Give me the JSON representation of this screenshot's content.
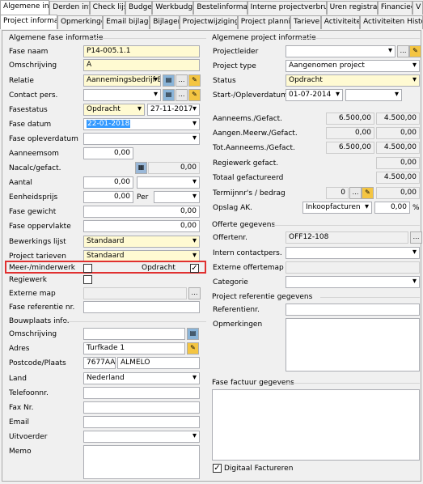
{
  "tabs_row1": [
    "Algemene info.",
    "Derden info",
    "Check lijst",
    "Budget",
    "Werkbudget",
    "Bestelinformatie",
    "Interne projectverbruiken",
    "Uren registratie",
    "Financieel",
    "V"
  ],
  "tabs_row2": [
    "Project informatie",
    "Opmerkingen",
    "Email bijlagen",
    "Bijlagen",
    "Projectwijzigingen",
    "Project planning",
    "Tarieven",
    "Activiteiten",
    "Activiteiten Historie"
  ],
  "left": {
    "header": "Algemene fase informatie",
    "fase_naam": {
      "label": "Fase naam",
      "value": "P14-005.1.1"
    },
    "omschrijving": {
      "label": "Omschrijving",
      "value": "A"
    },
    "relatie": {
      "label": "Relatie",
      "value": "Aannemingsbedrijf Ben"
    },
    "contact": {
      "label": "Contact pers.",
      "value": ""
    },
    "fasestatus": {
      "label": "Fasestatus",
      "value": "Opdracht",
      "date": "27-11-2017"
    },
    "fase_datum": {
      "label": "Fase datum",
      "value": "22-01-2018"
    },
    "fase_oplever": {
      "label": "Fase opleverdatum",
      "value": ""
    },
    "aanneemsom": {
      "label": "Aanneemsom",
      "value": "0,00"
    },
    "nacalc": {
      "label": "Nacalc/gefact.",
      "value": "0,00"
    },
    "aantal": {
      "label": "Aantal",
      "value": "0,00"
    },
    "eenheidsprijs": {
      "label": "Eenheidsprijs",
      "value": "0,00",
      "per": "Per"
    },
    "fase_gewicht": {
      "label": "Fase gewicht",
      "value": "0,00"
    },
    "fase_oppervlakte": {
      "label": "Fase oppervlakte",
      "value": "0,00"
    },
    "bewerkings": {
      "label": "Bewerkings lijst",
      "value": "Standaard"
    },
    "project_tarieven": {
      "label": "Project tarieven",
      "value": "Standaard"
    },
    "meerminder": {
      "label": "Meer-/minderwerk",
      "opdracht": "Opdracht"
    },
    "regiewerk": {
      "label": "Regiewerk"
    },
    "externe_map": {
      "label": "Externe map"
    },
    "fase_ref": {
      "label": "Fase referentie nr."
    },
    "bouwplaats_header": "Bouwplaats info.",
    "b_omschrijving": {
      "label": "Omschrijving"
    },
    "adres": {
      "label": "Adres",
      "value": "Turfkade 1"
    },
    "postcode": {
      "label": "Postcode/Plaats",
      "postcode": "7677AA",
      "plaats": "ALMELO"
    },
    "land": {
      "label": "Land",
      "value": "Nederland"
    },
    "telefoon": {
      "label": "Telefoonnr."
    },
    "fax": {
      "label": "Fax Nr."
    },
    "email": {
      "label": "Email"
    },
    "uitvoerder": {
      "label": "Uitvoerder"
    },
    "memo": {
      "label": "Memo"
    }
  },
  "right": {
    "header": "Algemene project informatie",
    "projectleider": {
      "label": "Projectleider"
    },
    "project_type": {
      "label": "Project type",
      "value": "Aangenomen project"
    },
    "status": {
      "label": "Status",
      "value": "Opdracht"
    },
    "start": {
      "label": "Start-/Opleverdatum",
      "value": "01-07-2014"
    },
    "aanneems": {
      "label": "Aanneems./Gefact.",
      "a": "6.500,00",
      "b": "4.500,00"
    },
    "aangen": {
      "label": "Aangen.Meerw./Gefact.",
      "a": "0,00",
      "b": "0,00"
    },
    "tot": {
      "label": "Tot.Aanneems./Gefact.",
      "a": "6.500,00",
      "b": "4.500,00"
    },
    "regiewerk": {
      "label": "Regiewerk gefact.",
      "b": "0,00"
    },
    "totaal": {
      "label": "Totaal gefactureerd",
      "b": "4.500,00"
    },
    "termijn": {
      "label": "Termijnnr's / bedrag",
      "a": "0",
      "b": "0,00"
    },
    "opslag": {
      "label": "Opslag AK.",
      "value": "Inkoopfacturen",
      "pct": "0,00",
      "unit": "%"
    },
    "offerte_header": "Offerte gegevens",
    "offertenr": {
      "label": "Offertenr.",
      "value": "OFF12-108"
    },
    "intern": {
      "label": "Intern contactpers."
    },
    "externe_offerte": {
      "label": "Externe offertemap"
    },
    "categorie": {
      "label": "Categorie"
    },
    "ref_header": "Project referentie gegevens",
    "referentienr": {
      "label": "Referentienr."
    },
    "opmerkingen": {
      "label": "Opmerkingen"
    },
    "factuur_header": "Fase factuur gegevens",
    "digitaal": {
      "label": "Digitaal Factureren"
    }
  },
  "colors": {
    "yellow": "#fffad2",
    "highlight": "#e03030",
    "selection": "#3399ff"
  }
}
